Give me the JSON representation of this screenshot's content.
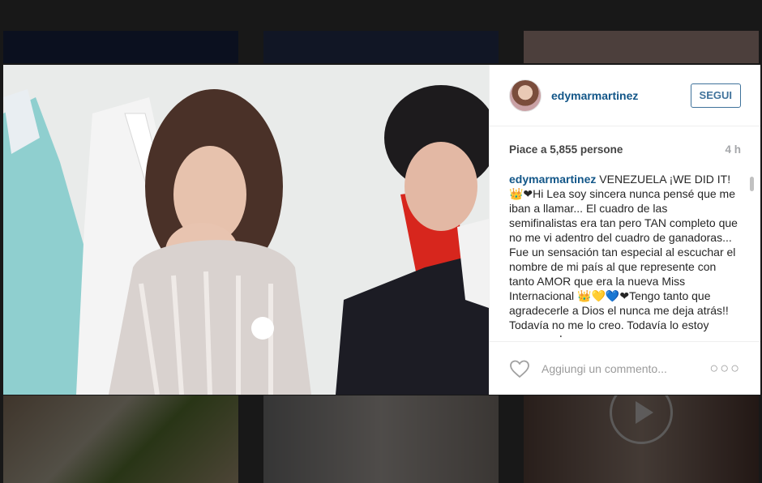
{
  "post": {
    "username": "edymarmartinez",
    "follow_label": "SEGUI",
    "likes_text": "Piace a 5,855 persone",
    "time_ago": "4 h",
    "caption_author": "edymarmartinez",
    "caption_text": " VENEZUELA ¡WE DID IT! 👑❤Hi Lea soy sincera nunca pensé que me iban a llamar... El cuadro de las semifinalistas era tan pero TAN completo que no me vi adentro del cuadro de ganadoras... Fue un sensación tan especial al escuchar el nombre de mi país al que represente con tanto AMOR que era la nueva Miss Internacional 👑💛💙❤Tengo tanto que agradecerle a Dios el nunca me deja atrás!! Todavía no me lo creo. Todavía lo estoy procesando.",
    "comment_placeholder": "Aggiungi un commento...",
    "more_label": "○○○"
  },
  "colors": {
    "username": "#125688",
    "follow": "#3f729b",
    "muted": "#9b9b9b"
  },
  "icons": {
    "heart": "heart-outline-icon",
    "more": "more-options-icon",
    "play": "play-icon"
  }
}
